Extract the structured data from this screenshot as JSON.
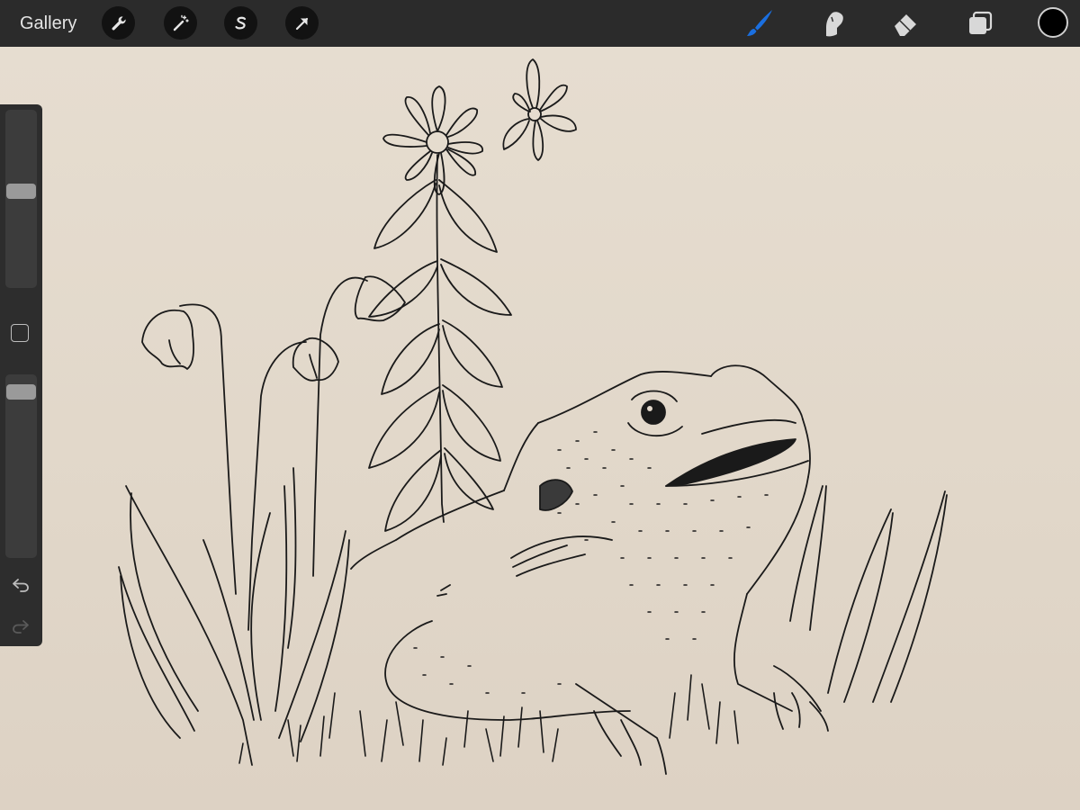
{
  "toolbar": {
    "gallery_label": "Gallery",
    "left_tools": [
      "wrench-icon",
      "magic-wand-icon",
      "selection-s-icon",
      "transform-arrow-icon"
    ],
    "right_tools": [
      "brush-icon",
      "smudge-icon",
      "eraser-icon",
      "layers-icon"
    ],
    "active_tool": "brush",
    "active_color": "#000000",
    "accent_color": "#1a6fe0"
  },
  "sidebar": {
    "brush_size_level": 0.55,
    "brush_opacity_level": 0.96,
    "icons": [
      "modify-square-icon",
      "undo-icon",
      "redo-icon"
    ]
  },
  "canvas": {
    "paper_color": "#e3d9cc",
    "ink_color": "#1a1a1a",
    "subject": [
      "toad",
      "daisy-flowers",
      "snowdrop-bells",
      "grass-blades"
    ]
  }
}
